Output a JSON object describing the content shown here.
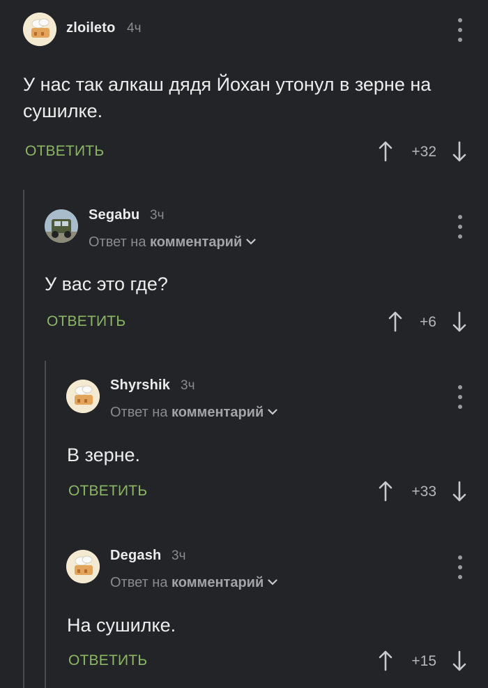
{
  "reply_prefix": "Ответ на",
  "reply_target": "комментарий",
  "reply_button_label": "ОТВЕТИТЬ",
  "colors": {
    "accent": "#8bb765",
    "background": "#232427",
    "muted": "#8a8b8f"
  },
  "comments": [
    {
      "user": "zloileto",
      "time": "4ч",
      "avatar": "chef-hat-avatar-icon",
      "text": "У нас так алкаш дядя Йохан утонул в зерне на сушилке.",
      "score": "+32"
    },
    {
      "user": "Segabu",
      "time": "3ч",
      "avatar": "truck-photo-avatar-icon",
      "text": "У вас это где?",
      "score": "+6"
    },
    {
      "user": "Shyrshik",
      "time": "3ч",
      "avatar": "chef-hat-avatar-icon",
      "text": "В зерне.",
      "score": "+33"
    },
    {
      "user": "Degash",
      "time": "3ч",
      "avatar": "chef-hat-avatar-icon",
      "text": "На сушилке.",
      "score": "+15"
    }
  ]
}
